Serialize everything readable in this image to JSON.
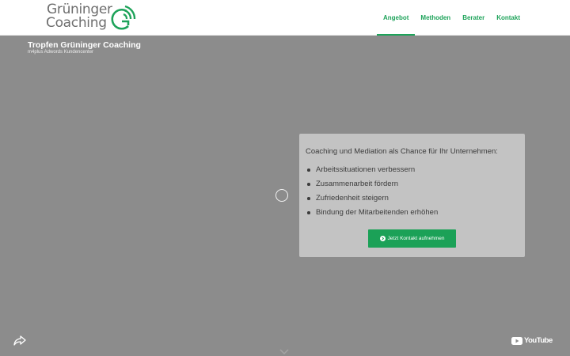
{
  "header": {
    "logo": {
      "line1": "Grüninger",
      "line2": "Coaching",
      "mark_icon": "target-g-logo-icon"
    },
    "nav": [
      {
        "label": "Angebot",
        "active": true
      },
      {
        "label": "Methoden",
        "active": false
      },
      {
        "label": "Berater",
        "active": false
      },
      {
        "label": "Kontakt",
        "active": false
      }
    ]
  },
  "video": {
    "title": "Tropfen Grüninger Coaching",
    "channel": "m4plus Adwords Kundencenter",
    "spinner_icon": "loading-spinner-icon",
    "share_icon": "share-arrow-icon",
    "youtube": {
      "icon": "youtube-logo-icon",
      "label": "YouTube"
    },
    "scroll_icon": "chevron-down-icon"
  },
  "card": {
    "lead": "Coaching und Mediation als Chance für Ihr Unternehmen:",
    "items": [
      "Arbeitssituationen verbessern",
      "Zusammenarbeit fördern",
      "Zufriedenheit steigern",
      "Bindung der Mitarbeitenden erhöhen"
    ],
    "cta": {
      "icon": "chevron-circle-right-icon",
      "label": "Jetzt Kontakt aufnehmen"
    }
  },
  "colors": {
    "accent": "#1ea35a",
    "video_bg": "#8c8c8c",
    "card_bg": "#c3c3c3"
  }
}
